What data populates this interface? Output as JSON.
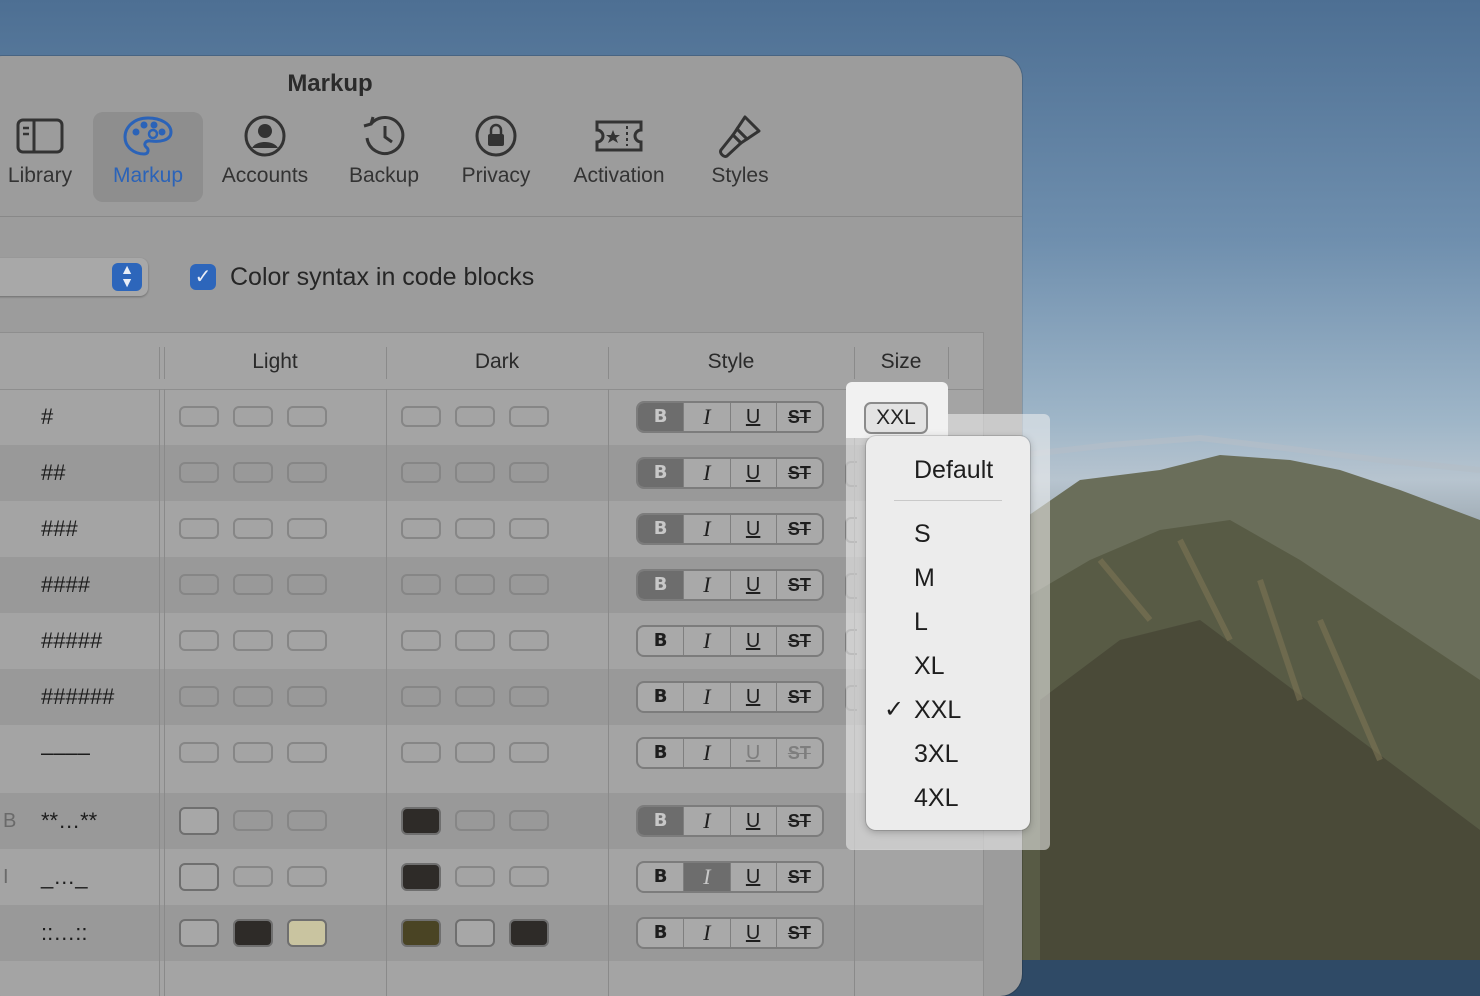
{
  "window": {
    "title": "Markup"
  },
  "toolbar": [
    {
      "label": "Library",
      "icon": "sidebar-icon"
    },
    {
      "label": "Markup",
      "icon": "palette-icon",
      "active": true
    },
    {
      "label": "Accounts",
      "icon": "person-circle-icon"
    },
    {
      "label": "Backup",
      "icon": "clock-history-icon"
    },
    {
      "label": "Privacy",
      "icon": "lock-icon"
    },
    {
      "label": "Activation",
      "icon": "ticket-icon"
    },
    {
      "label": "Styles",
      "icon": "paintbrush-icon"
    }
  ],
  "options": {
    "color_syntax_label": "Color syntax in code blocks",
    "color_syntax_checked": true,
    "checkmark": "✓"
  },
  "table": {
    "headers": {
      "light": "Light",
      "dark": "Dark",
      "style": "Style",
      "size": "Size"
    },
    "style_labels": {
      "bold": "B",
      "italic": "I",
      "underline": "U",
      "strike": "ST"
    },
    "rows": [
      {
        "markup": "#",
        "letter": ""
      },
      {
        "markup": "##",
        "letter": ""
      },
      {
        "markup": "###",
        "letter": ""
      },
      {
        "markup": "####",
        "letter": ""
      },
      {
        "markup": "#####",
        "letter": ""
      },
      {
        "markup": "######",
        "letter": ""
      },
      {
        "markup": "––––",
        "letter": ""
      },
      {
        "markup": "**…**",
        "letter": "B"
      },
      {
        "markup": "_…_",
        "letter": "I"
      },
      {
        "markup": "::…::",
        "letter": ""
      }
    ],
    "selected_size": "XXL"
  },
  "colors": {
    "accent": "#2d66bb",
    "dark_swatch": "#2e2b28",
    "olive_swatch": "#4a4424",
    "light_swatch": "#c9c4a0"
  },
  "size_menu": {
    "default_label": "Default",
    "options": [
      "S",
      "M",
      "L",
      "XL",
      "XXL",
      "3XL",
      "4XL"
    ],
    "checked": "XXL"
  }
}
